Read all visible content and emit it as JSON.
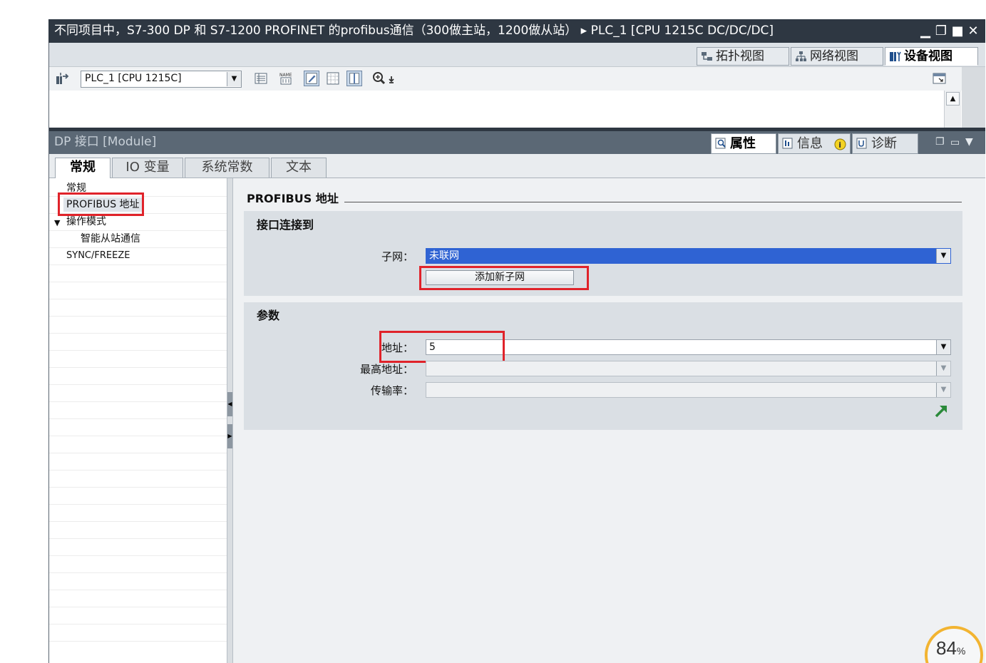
{
  "window": {
    "title": "不同项目中，S7-300 DP 和 S7-1200 PROFINET 的profibus通信（300做主站，1200做从站） ▸ PLC_1 [CPU 1215C DC/DC/DC]",
    "controls": [
      "minimize",
      "restore",
      "maximize",
      "close"
    ]
  },
  "view_tabs": [
    {
      "label": "拓扑视图",
      "icon": "topology-view-icon"
    },
    {
      "label": "网络视图",
      "icon": "network-view-icon"
    },
    {
      "label": "设备视图",
      "icon": "device-view-icon",
      "active": true
    }
  ],
  "toolbar": {
    "device_select": "PLC_1 [CPU 1215C]",
    "icons": [
      "device-change-icon",
      "device-overview-icon",
      "show-names-icon",
      "draw-edit-icon",
      "grid-icon",
      "page-break-icon",
      "zoom-icon"
    ]
  },
  "inspector": {
    "title": "DP 接口 [Module]",
    "tabs": [
      {
        "label": "属性",
        "active": true
      },
      {
        "label": "信息"
      },
      {
        "label": "诊断"
      }
    ]
  },
  "subtabs": [
    {
      "label": "常规",
      "active": true
    },
    {
      "label": "IO 变量"
    },
    {
      "label": "系统常数"
    },
    {
      "label": "文本"
    }
  ],
  "nav": {
    "items": [
      {
        "label": "常规",
        "indent": 0
      },
      {
        "label": "PROFIBUS 地址",
        "indent": 0,
        "selected": true
      },
      {
        "label": "操作模式",
        "indent": 0,
        "expanded": true
      },
      {
        "label": "智能从站通信",
        "indent": 1
      },
      {
        "label": "SYNC/FREEZE",
        "indent": 0
      }
    ]
  },
  "main": {
    "heading": "PROFIBUS 地址",
    "interface_section": {
      "title": "接口连接到",
      "subnet_label": "子网：",
      "subnet_value": "未联网",
      "add_subnet_button": "添加新子网"
    },
    "params_section": {
      "title": "参数",
      "address_label": "地址：",
      "address_value": "5",
      "highest_address_label": "最高地址：",
      "highest_address_value": "",
      "baud_rate_label": "传输率：",
      "baud_rate_value": ""
    }
  },
  "zoom_badge": "84",
  "zoom_unit": "%",
  "colors": {
    "titlebar": "#2e3742",
    "inspector_bar": "#5b6875",
    "selection_blue": "#2f63d3",
    "highlight_red": "#e0232a",
    "section_bg": "#dadfe4"
  }
}
